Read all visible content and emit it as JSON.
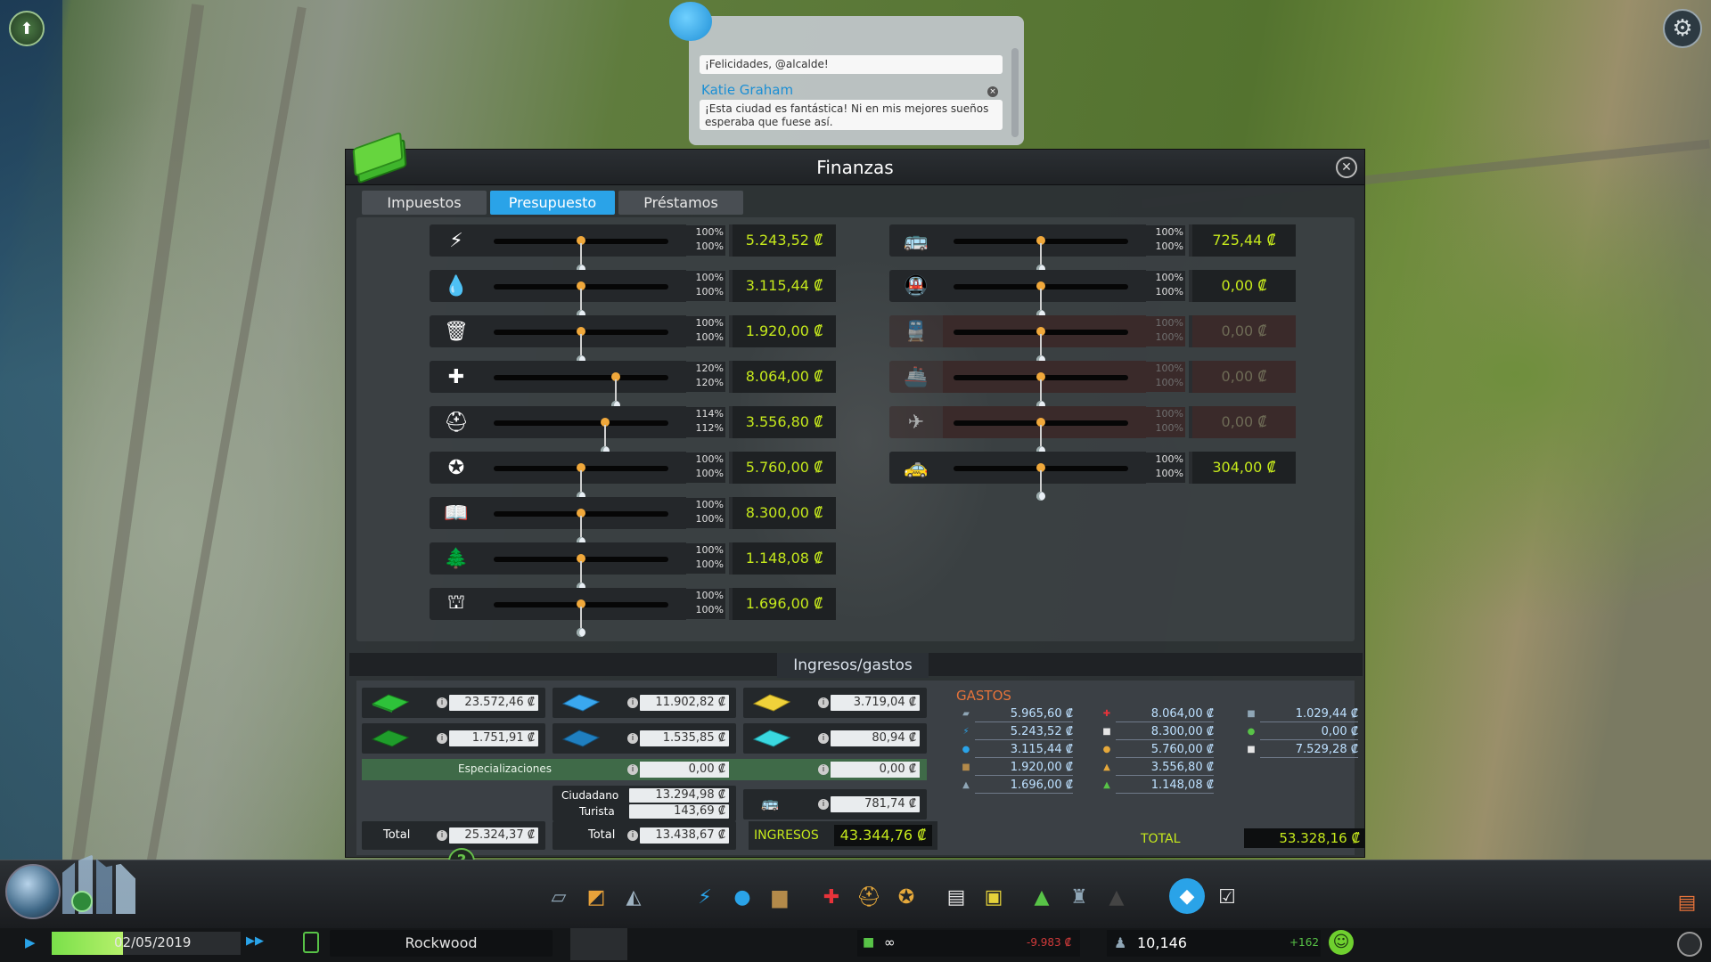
{
  "chirper": {
    "message1": "¡Felicidades, @alcalde!",
    "author": "Katie Graham",
    "message2": "¡Esta ciudad es fantástica! Ni en mis mejores sueños esperaba que fuese así."
  },
  "finance": {
    "title": "Finanzas",
    "tabs": [
      "Impuestos",
      "Presupuesto",
      "Préstamos"
    ],
    "active_tab": "Presupuesto",
    "budget_left": [
      {
        "icon": "electricity-icon",
        "glyph": "⚡",
        "day": "100%",
        "night": "100%",
        "amount": "5.243,52 ₡",
        "fill": 0.5
      },
      {
        "icon": "water-icon",
        "glyph": "💧",
        "day": "100%",
        "night": "100%",
        "amount": "3.115,44 ₡",
        "fill": 0.5
      },
      {
        "icon": "garbage-icon",
        "glyph": "🗑",
        "day": "100%",
        "night": "100%",
        "amount": "1.920,00 ₡",
        "fill": 0.5
      },
      {
        "icon": "healthcare-icon",
        "glyph": "✚",
        "day": "120%",
        "night": "120%",
        "amount": "8.064,00 ₡",
        "fill": 0.7
      },
      {
        "icon": "fire-icon",
        "glyph": "⛑",
        "day": "114%",
        "night": "112%",
        "amount": "3.556,80 ₡",
        "fill": 0.64
      },
      {
        "icon": "police-icon",
        "glyph": "✪",
        "day": "100%",
        "night": "100%",
        "amount": "5.760,00 ₡",
        "fill": 0.5
      },
      {
        "icon": "education-icon",
        "glyph": "📖",
        "day": "100%",
        "night": "100%",
        "amount": "8.300,00 ₡",
        "fill": 0.5
      },
      {
        "icon": "parks-icon",
        "glyph": "🌲",
        "day": "100%",
        "night": "100%",
        "amount": "1.148,08 ₡",
        "fill": 0.5
      },
      {
        "icon": "monuments-icon",
        "glyph": "⛫",
        "day": "100%",
        "night": "100%",
        "amount": "1.696,00 ₡",
        "fill": 0.5
      }
    ],
    "budget_right": [
      {
        "icon": "bus-icon",
        "glyph": "🚌",
        "day": "100%",
        "night": "100%",
        "amount": "725,44 ₡",
        "fill": 0.5,
        "disabled": false
      },
      {
        "icon": "metro-icon",
        "glyph": "🚇",
        "day": "100%",
        "night": "100%",
        "amount": "0,00 ₡",
        "fill": 0.5,
        "disabled": false
      },
      {
        "icon": "train-icon",
        "glyph": "🚆",
        "day": "100%",
        "night": "100%",
        "amount": "0,00 ₡",
        "fill": 0.5,
        "disabled": true
      },
      {
        "icon": "ship-icon",
        "glyph": "🚢",
        "day": "100%",
        "night": "100%",
        "amount": "0,00 ₡",
        "fill": 0.5,
        "disabled": true
      },
      {
        "icon": "plane-icon",
        "glyph": "✈",
        "day": "100%",
        "night": "100%",
        "amount": "0,00 ₡",
        "fill": 0.5,
        "disabled": true
      },
      {
        "icon": "taxi-icon",
        "glyph": "🚕",
        "day": "100%",
        "night": "100%",
        "amount": "304,00 ₡",
        "fill": 0.5,
        "disabled": false
      }
    ],
    "income_expenses": {
      "title": "Ingresos/gastos",
      "residential_low": "23.572,46 ₡",
      "residential_high": "1.751,91 ₡",
      "commercial_low": "11.902,82 ₡",
      "commercial_high": "1.535,85 ₡",
      "industrial": "3.719,04 ₡",
      "office": "80,94 ₡",
      "specializations_label": "Especializaciones",
      "specializations_comm": "0,00 ₡",
      "specializations_ind": "0,00 ₡",
      "citizen_label": "Ciudadano",
      "citizen_value": "13.294,98 ₡",
      "tourist_label": "Turista",
      "tourist_value": "143,69 ₡",
      "transport_income": "781,74 ₡",
      "total_label": "Total",
      "total_res": "25.324,37 ₡",
      "total_comm": "13.438,67 ₡",
      "ingresos_label": "INGRESOS",
      "ingresos_value": "43.344,76 ₡",
      "gastos_title": "GASTOS",
      "gastos": [
        {
          "icon": "roads-icon",
          "glyph": "▰",
          "color": "#8fa6b6",
          "value": "5.965,60 ₡"
        },
        {
          "icon": "electricity-icon",
          "glyph": "⚡",
          "color": "#2aa3e8",
          "value": "5.243,52 ₡"
        },
        {
          "icon": "water-icon",
          "glyph": "●",
          "color": "#2aa3e8",
          "value": "3.115,44 ₡"
        },
        {
          "icon": "garbage-icon",
          "glyph": "■",
          "color": "#b38a4a",
          "value": "1.920,00 ₡"
        },
        {
          "icon": "monuments-icon",
          "glyph": "▲",
          "color": "#8fa6b6",
          "value": "1.696,00 ₡"
        },
        {
          "icon": "healthcare-icon",
          "glyph": "✚",
          "color": "#e8333a",
          "value": "8.064,00 ₡"
        },
        {
          "icon": "education-icon",
          "glyph": "■",
          "color": "#e5e5e5",
          "value": "8.300,00 ₡"
        },
        {
          "icon": "police-icon",
          "glyph": "●",
          "color": "#e5a83b",
          "value": "5.760,00 ₡"
        },
        {
          "icon": "fire-icon",
          "glyph": "▲",
          "color": "#e5a83b",
          "value": "3.556,80 ₡"
        },
        {
          "icon": "parks-icon",
          "glyph": "▲",
          "color": "#58c347",
          "value": "1.148,08 ₡"
        },
        {
          "icon": "public-transport-icon",
          "glyph": "■",
          "color": "#8fa6b6",
          "value": "1.029,44 ₡"
        },
        {
          "icon": "policies-icon",
          "glyph": "●",
          "color": "#58c347",
          "value": "0,00 ₡"
        },
        {
          "icon": "loans-icon",
          "glyph": "■",
          "color": "#e5e5e5",
          "value": "7.529,28 ₡"
        }
      ],
      "total_gastos_label": "TOTAL",
      "total_gastos_value": "53.328,16 ₡"
    }
  },
  "statusbar": {
    "date": "02/05/2019",
    "city_name": "Rockwood",
    "money": "∞",
    "money_delta": "-9.983 ₡",
    "population": "10,146",
    "population_delta": "+162"
  },
  "colors": {
    "accent": "#2aa3e8",
    "money": "#c5e81c",
    "expense": "#e6733a"
  }
}
